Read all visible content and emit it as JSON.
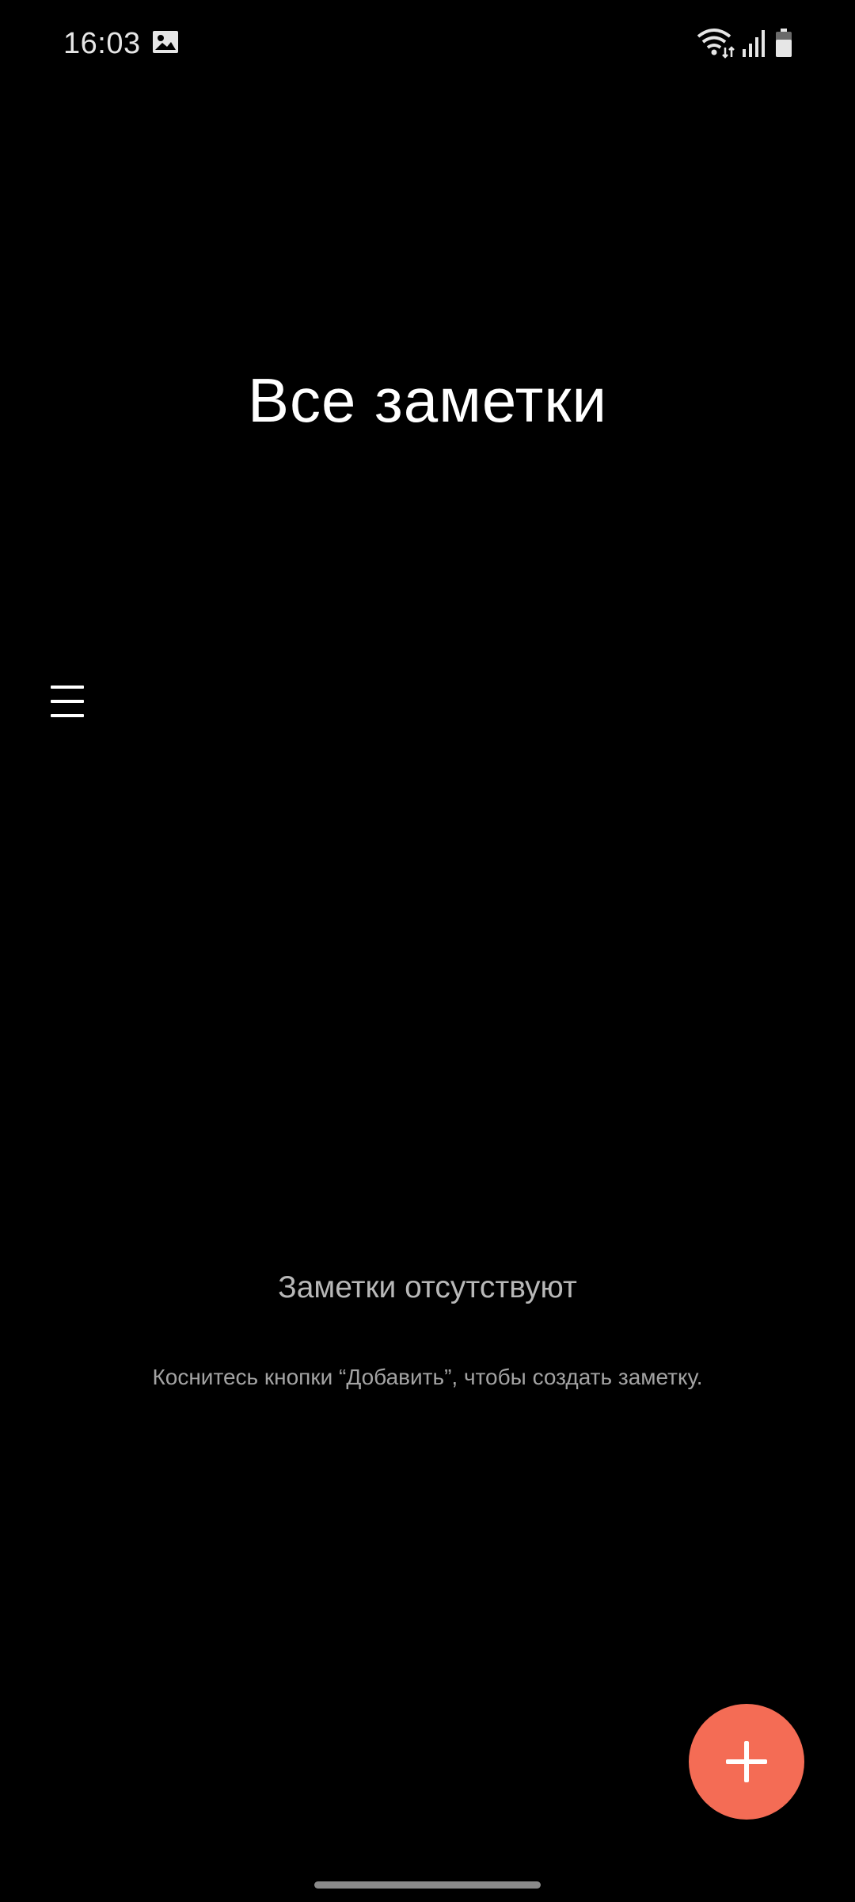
{
  "status_bar": {
    "time": "16:03",
    "icons": [
      "gallery-notification-icon",
      "wifi-icon",
      "signal-icon",
      "battery-icon"
    ]
  },
  "main": {
    "title": "Все заметки",
    "menu_icon": "hamburger-menu-icon"
  },
  "empty_state": {
    "title": "Заметки отсутствуют",
    "hint": "Коснитесь кнопки “Добавить”, чтобы создать заметку."
  },
  "fab": {
    "icon": "plus-icon",
    "color": "#f46c55"
  },
  "colors": {
    "background": "#000000",
    "accent": "#f46c55",
    "text_primary": "#ffffff",
    "text_secondary": "#b8b8b8"
  }
}
